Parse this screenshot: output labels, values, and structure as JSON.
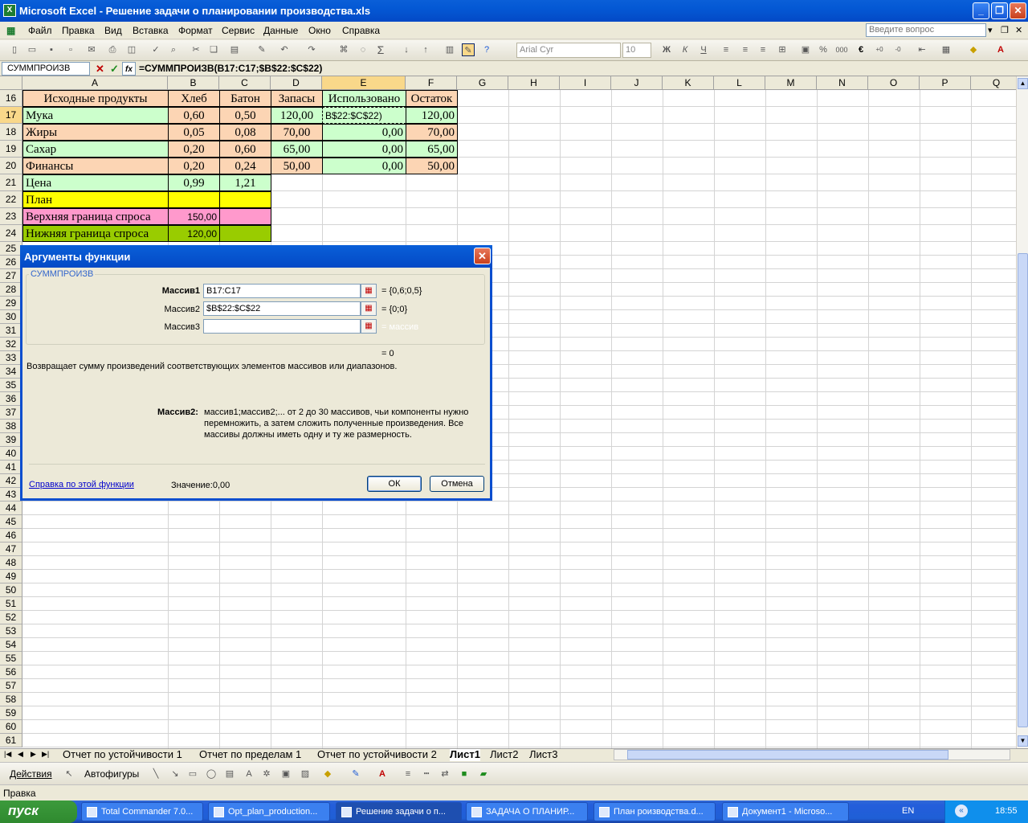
{
  "window": {
    "title": "Microsoft Excel - Решение задачи о планировании производства.xls",
    "minimize": "_",
    "restore": "❐",
    "close": "✕"
  },
  "menu": {
    "items": [
      "Файл",
      "Правка",
      "Вид",
      "Вставка",
      "Формат",
      "Сервис",
      "Данные",
      "Окно",
      "Справка"
    ],
    "ask_placeholder": "Введите вопрос"
  },
  "toolbar": {
    "font_name": "Arial Cyr",
    "font_size": "10",
    "bold": "Ж",
    "italic": "К",
    "underline": "Ч",
    "percent": "%",
    "thousands": "000",
    "euro": "€",
    "sum": "Σ"
  },
  "formula_bar": {
    "name_box": "СУММПРОИЗВ",
    "cancel": "✕",
    "enter": "✓",
    "fx": "fx",
    "formula": "=СУММПРОИЗВ(B17:C17;$B$22:$C$22)"
  },
  "columns": [
    "A",
    "B",
    "C",
    "D",
    "E",
    "F",
    "G",
    "H",
    "I",
    "J",
    "K",
    "L",
    "M",
    "N",
    "O",
    "P",
    "Q"
  ],
  "rows_visible": [
    "16",
    "17",
    "18",
    "19",
    "20",
    "21",
    "22",
    "23",
    "24",
    "25",
    "26",
    "27",
    "28",
    "29",
    "30",
    "31",
    "32",
    "33",
    "34",
    "35",
    "36",
    "37",
    "38",
    "39",
    "40",
    "41",
    "42",
    "43",
    "44",
    "45",
    "46",
    "47",
    "48",
    "49",
    "50",
    "51",
    "52",
    "53",
    "54",
    "55",
    "56",
    "57",
    "58",
    "59",
    "60",
    "61"
  ],
  "sheet": {
    "headers": [
      "Исходные продукты",
      "Хлеб",
      "Батон",
      "Запасы",
      "Использовано",
      "Остаток"
    ],
    "r17": [
      "Мука",
      "0,60",
      "0,50",
      "120,00",
      "B$22:$C$22)",
      "120,00"
    ],
    "r18": [
      "Жиры",
      "0,05",
      "0,08",
      "70,00",
      "0,00",
      "70,00"
    ],
    "r19": [
      "Сахар",
      "0,20",
      "0,60",
      "65,00",
      "0,00",
      "65,00"
    ],
    "r20": [
      "Финансы",
      "0,20",
      "0,24",
      "50,00",
      "0,00",
      "50,00"
    ],
    "r21": [
      "Цена",
      "0,99",
      "1,21"
    ],
    "r22": [
      "План"
    ],
    "r23": [
      "Верхняя граница спроса",
      "150,00"
    ],
    "r24": [
      "Нижняя граница спроса",
      "120,00"
    ]
  },
  "colors": {
    "peach": "#fcd5b4",
    "green": "#ccffcc",
    "yellow": "#ffff00",
    "pink": "#ff99cc",
    "olive": "#99cc00",
    "xp_blue": "#0a5fd8"
  },
  "dialog": {
    "title": "Аргументы функции",
    "close": "✕",
    "function_name": "СУММПРОИЗВ",
    "args": [
      {
        "label": "Массив1",
        "value": "B17:C17",
        "result": "= {0,6;0,5}"
      },
      {
        "label": "Массив2",
        "value": "$B$22:$C$22",
        "result": "= {0;0}"
      },
      {
        "label": "Массив3",
        "value": "",
        "result": "= массив"
      }
    ],
    "total": "= 0",
    "description": "Возвращает сумму произведений соответствующих элементов массивов или диапазонов.",
    "arg_help_label": "Массив2:",
    "arg_help": "массив1;массив2;... от 2 до 30 массивов, чьи компоненты нужно перемножить, а затем сложить полученные произведения. Все массивы должны иметь одну и ту же размерность.",
    "help_link": "Справка по этой функции",
    "value_label": "Значение:",
    "value": "0,00",
    "ok": "ОК",
    "cancel": "Отмена"
  },
  "tabs": [
    "Отчет по устойчивости 1",
    "Отчет по пределам 1",
    "Отчет по устойчивости 2",
    "Лист1",
    "Лист2",
    "Лист3"
  ],
  "active_tab": "Лист1",
  "drawbar": {
    "actions": "Действия",
    "autoshapes": "Автофигуры"
  },
  "status": "Правка",
  "taskbar": {
    "start": "пуск",
    "tasks": [
      "Total Commander 7.0...",
      "Opt_plan_production...",
      "Решение задачи о п...",
      "ЗАДАЧА О ПЛАНИР...",
      "План роизводства.d...",
      "Документ1 - Microso..."
    ],
    "lang": "EN",
    "time": "18:55"
  }
}
